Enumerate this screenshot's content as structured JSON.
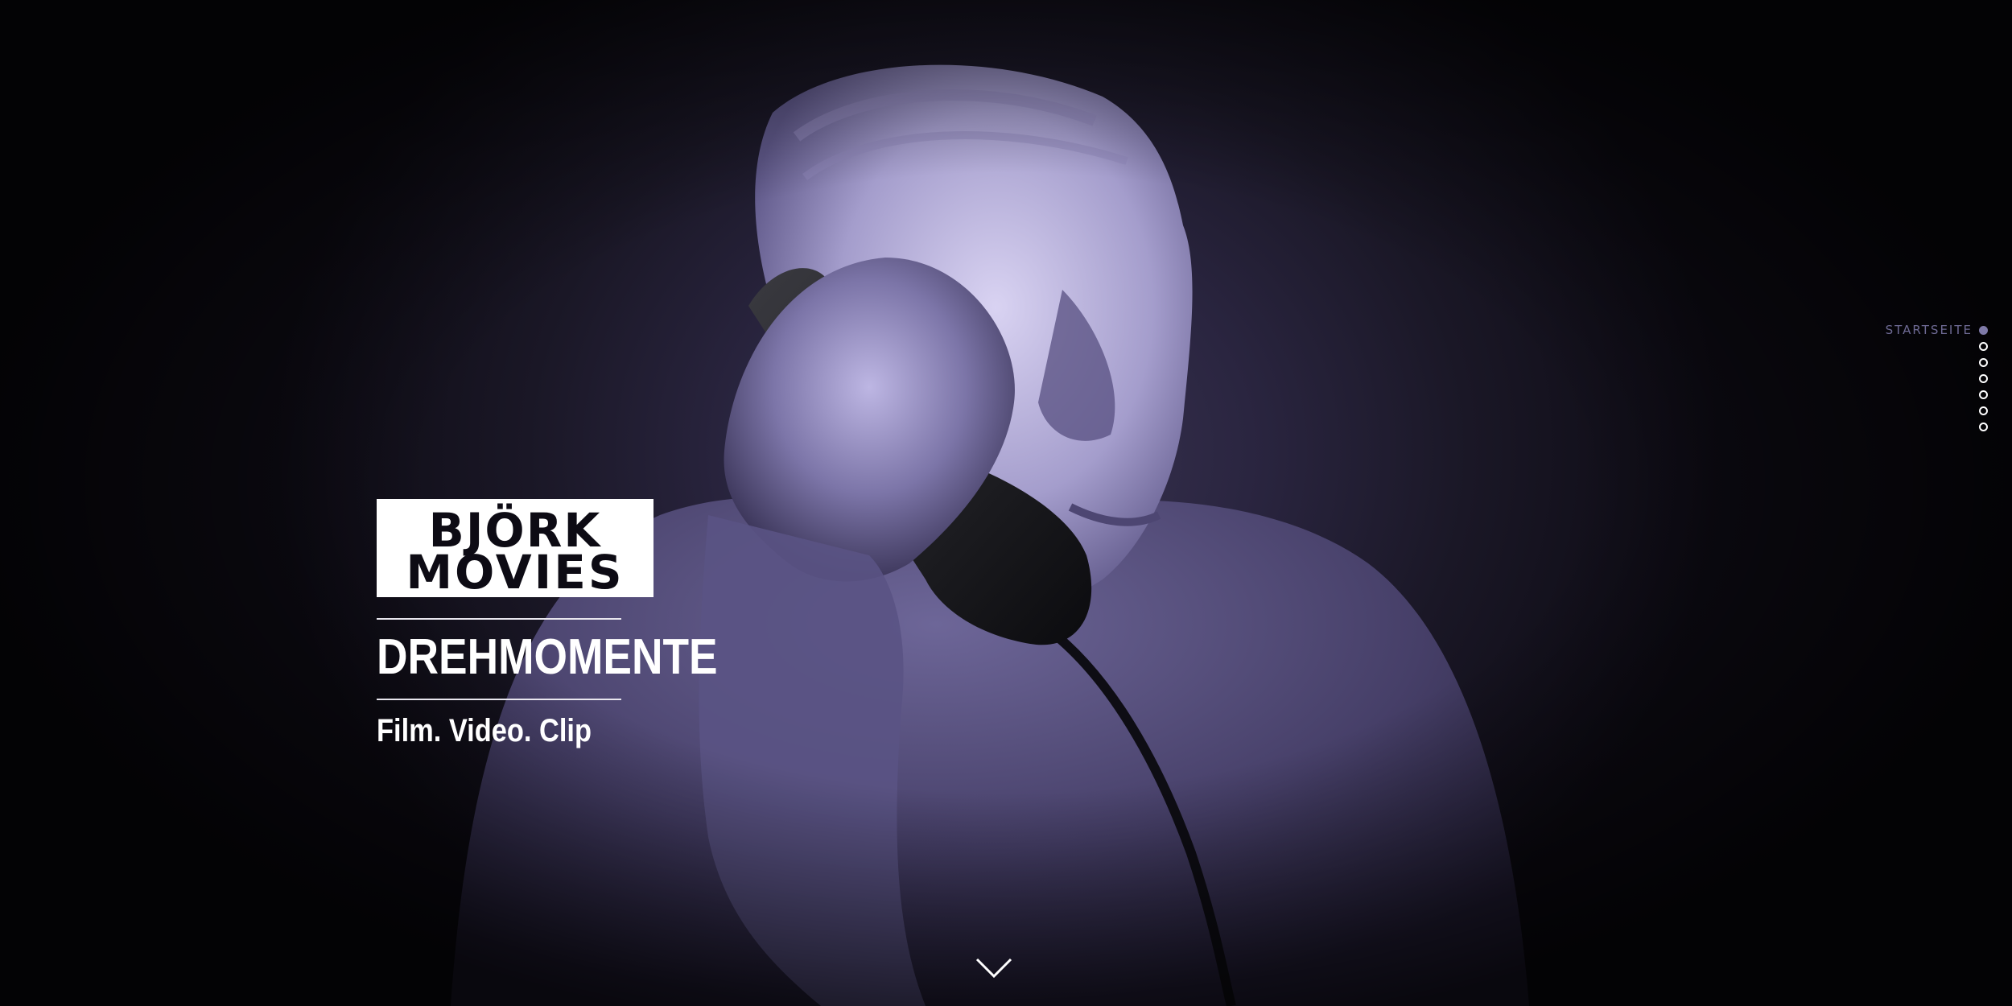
{
  "brand": {
    "logo_line1": "BJÖRK",
    "logo_line2": "MOVIES",
    "headline": "DREHMOMENTE",
    "tagline": "Film. Video. Clip"
  },
  "section_nav": {
    "active_label": "STARTSEITE",
    "items": [
      {
        "active": true
      },
      {
        "active": false
      },
      {
        "active": false
      },
      {
        "active": false
      },
      {
        "active": false
      },
      {
        "active": false
      },
      {
        "active": false
      }
    ]
  },
  "scroll_icon": "chevron-down-icon",
  "colors": {
    "background": "#0d0b14",
    "tint": "#8a84b8",
    "nav_label": "#6e6a94",
    "text": "#ffffff"
  }
}
